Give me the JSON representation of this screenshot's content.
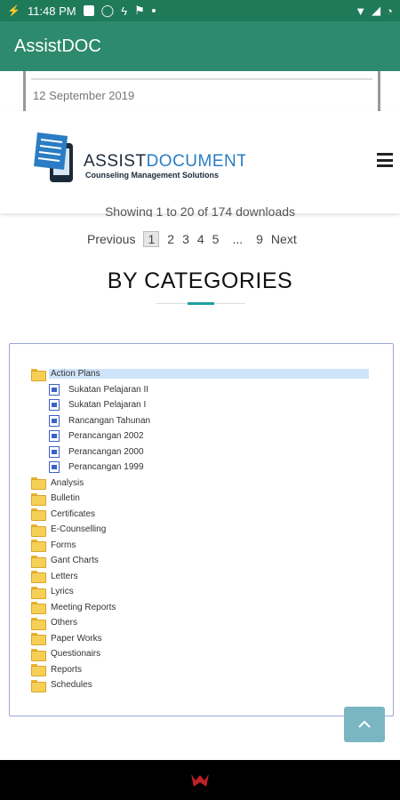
{
  "status_bar": {
    "time": "11:48 PM"
  },
  "app_bar": {
    "title": "AssistDOC"
  },
  "previous_item": {
    "date": "12 September 2019"
  },
  "site_header": {
    "logo": {
      "word_assist": "ASSIST",
      "word_document": "DOCUMENT",
      "tagline": "Counseling Management Solutions"
    }
  },
  "downloads": {
    "showing_text": "Showing 1 to 20 of 174 downloads",
    "pagination": {
      "previous": "Previous",
      "current": "1",
      "pages": [
        "2",
        "3",
        "4",
        "5"
      ],
      "ellipsis": "...",
      "last": "9",
      "next": "Next"
    }
  },
  "categories": {
    "heading": "BY CATEGORIES",
    "accent_color": "#1fa0a0",
    "expanded_folder": {
      "label": "Action Plans",
      "children": [
        "Sukatan Pelajaran II",
        "Sukatan Pelajaran I",
        "Rancangan Tahunan",
        "Perancangan 2002",
        "Perancangan 2000",
        "Perancangan 1999"
      ]
    },
    "folders": [
      "Analysis",
      "Bulletin",
      "Certificates",
      "E-Counselling",
      "Forms",
      "Gant Charts",
      "Letters",
      "Lyrics",
      "Meeting Reports",
      "Others",
      "Paper Works",
      "Questionairs",
      "Reports",
      "Schedules"
    ]
  },
  "colors": {
    "status_bar": "#1f7a5a",
    "app_bar": "#2d8a6c",
    "selection": "#cfe3fb",
    "scroll_top_button": "#7ab6c2"
  }
}
